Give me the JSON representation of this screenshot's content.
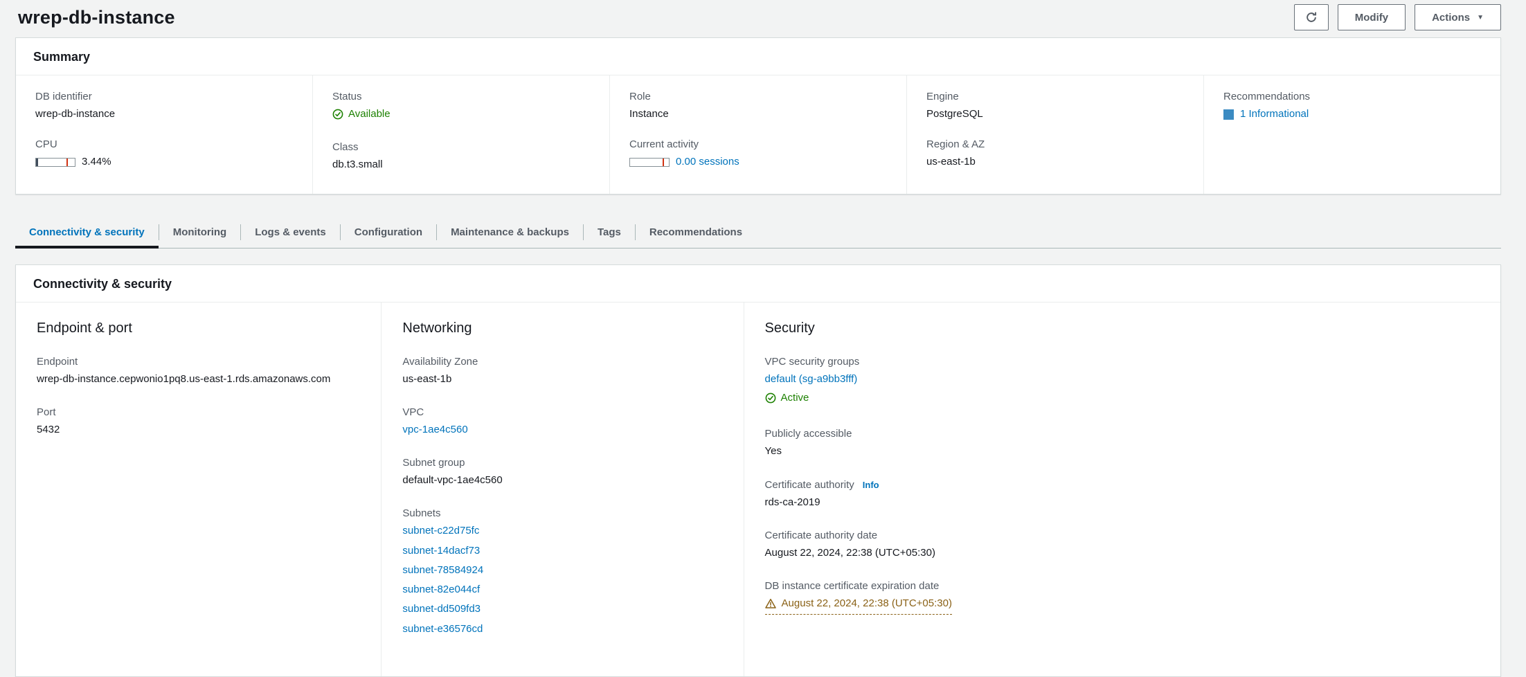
{
  "page": {
    "title": "wrep-db-instance"
  },
  "toolbar": {
    "modify_label": "Modify",
    "actions_label": "Actions"
  },
  "icons": {
    "refresh": "circular-arrow",
    "caret_down": "▼",
    "status_ok": "check-circle",
    "warning": "triangle-exclamation",
    "recommendation_severity": "blue-square"
  },
  "colors": {
    "link": "#0073bb",
    "success": "#1d8102",
    "warning": "#8a6116",
    "meter_marker": "#d13212",
    "meter_fill": "#414d5c",
    "recommendation_square": "#3b8bc2",
    "active_tab_underline": "#16191f"
  },
  "summary": {
    "title": "Summary",
    "db_identifier": {
      "label": "DB identifier",
      "value": "wrep-db-instance"
    },
    "cpu": {
      "label": "CPU",
      "value": "3.44%"
    },
    "status": {
      "label": "Status",
      "value": "Available"
    },
    "class": {
      "label": "Class",
      "value": "db.t3.small"
    },
    "role": {
      "label": "Role",
      "value": "Instance"
    },
    "current_activity": {
      "label": "Current activity",
      "value": "0.00 sessions"
    },
    "engine": {
      "label": "Engine",
      "value": "PostgreSQL"
    },
    "region_az": {
      "label": "Region & AZ",
      "value": "us-east-1b"
    },
    "recommendations": {
      "label": "Recommendations",
      "value": "1 Informational"
    }
  },
  "tabs": [
    {
      "label": "Connectivity & security",
      "active": true
    },
    {
      "label": "Monitoring",
      "active": false
    },
    {
      "label": "Logs & events",
      "active": false
    },
    {
      "label": "Configuration",
      "active": false
    },
    {
      "label": "Maintenance & backups",
      "active": false
    },
    {
      "label": "Tags",
      "active": false
    },
    {
      "label": "Recommendations",
      "active": false
    }
  ],
  "connectivity": {
    "title": "Connectivity & security",
    "endpoint_port": {
      "title": "Endpoint & port",
      "endpoint": {
        "label": "Endpoint",
        "value": "wrep-db-instance.cepwonio1pq8.us-east-1.rds.amazonaws.com"
      },
      "port": {
        "label": "Port",
        "value": "5432"
      }
    },
    "networking": {
      "title": "Networking",
      "availability_zone": {
        "label": "Availability Zone",
        "value": "us-east-1b"
      },
      "vpc": {
        "label": "VPC",
        "value": "vpc-1ae4c560"
      },
      "subnet_group": {
        "label": "Subnet group",
        "value": "default-vpc-1ae4c560"
      },
      "subnets": {
        "label": "Subnets",
        "items": [
          "subnet-c22d75fc",
          "subnet-14dacf73",
          "subnet-78584924",
          "subnet-82e044cf",
          "subnet-dd509fd3",
          "subnet-e36576cd"
        ]
      }
    },
    "security": {
      "title": "Security",
      "vpc_security_groups": {
        "label": "VPC security groups",
        "link": "default (sg-a9bb3fff)",
        "status": "Active"
      },
      "publicly_accessible": {
        "label": "Publicly accessible",
        "value": "Yes"
      },
      "certificate_authority": {
        "label": "Certificate authority",
        "info_label": "Info",
        "value": "rds-ca-2019"
      },
      "certificate_authority_date": {
        "label": "Certificate authority date",
        "value": "August 22, 2024, 22:38 (UTC+05:30)"
      },
      "certificate_expiration": {
        "label": "DB instance certificate expiration date",
        "value": "August 22, 2024, 22:38 (UTC+05:30)"
      }
    }
  }
}
